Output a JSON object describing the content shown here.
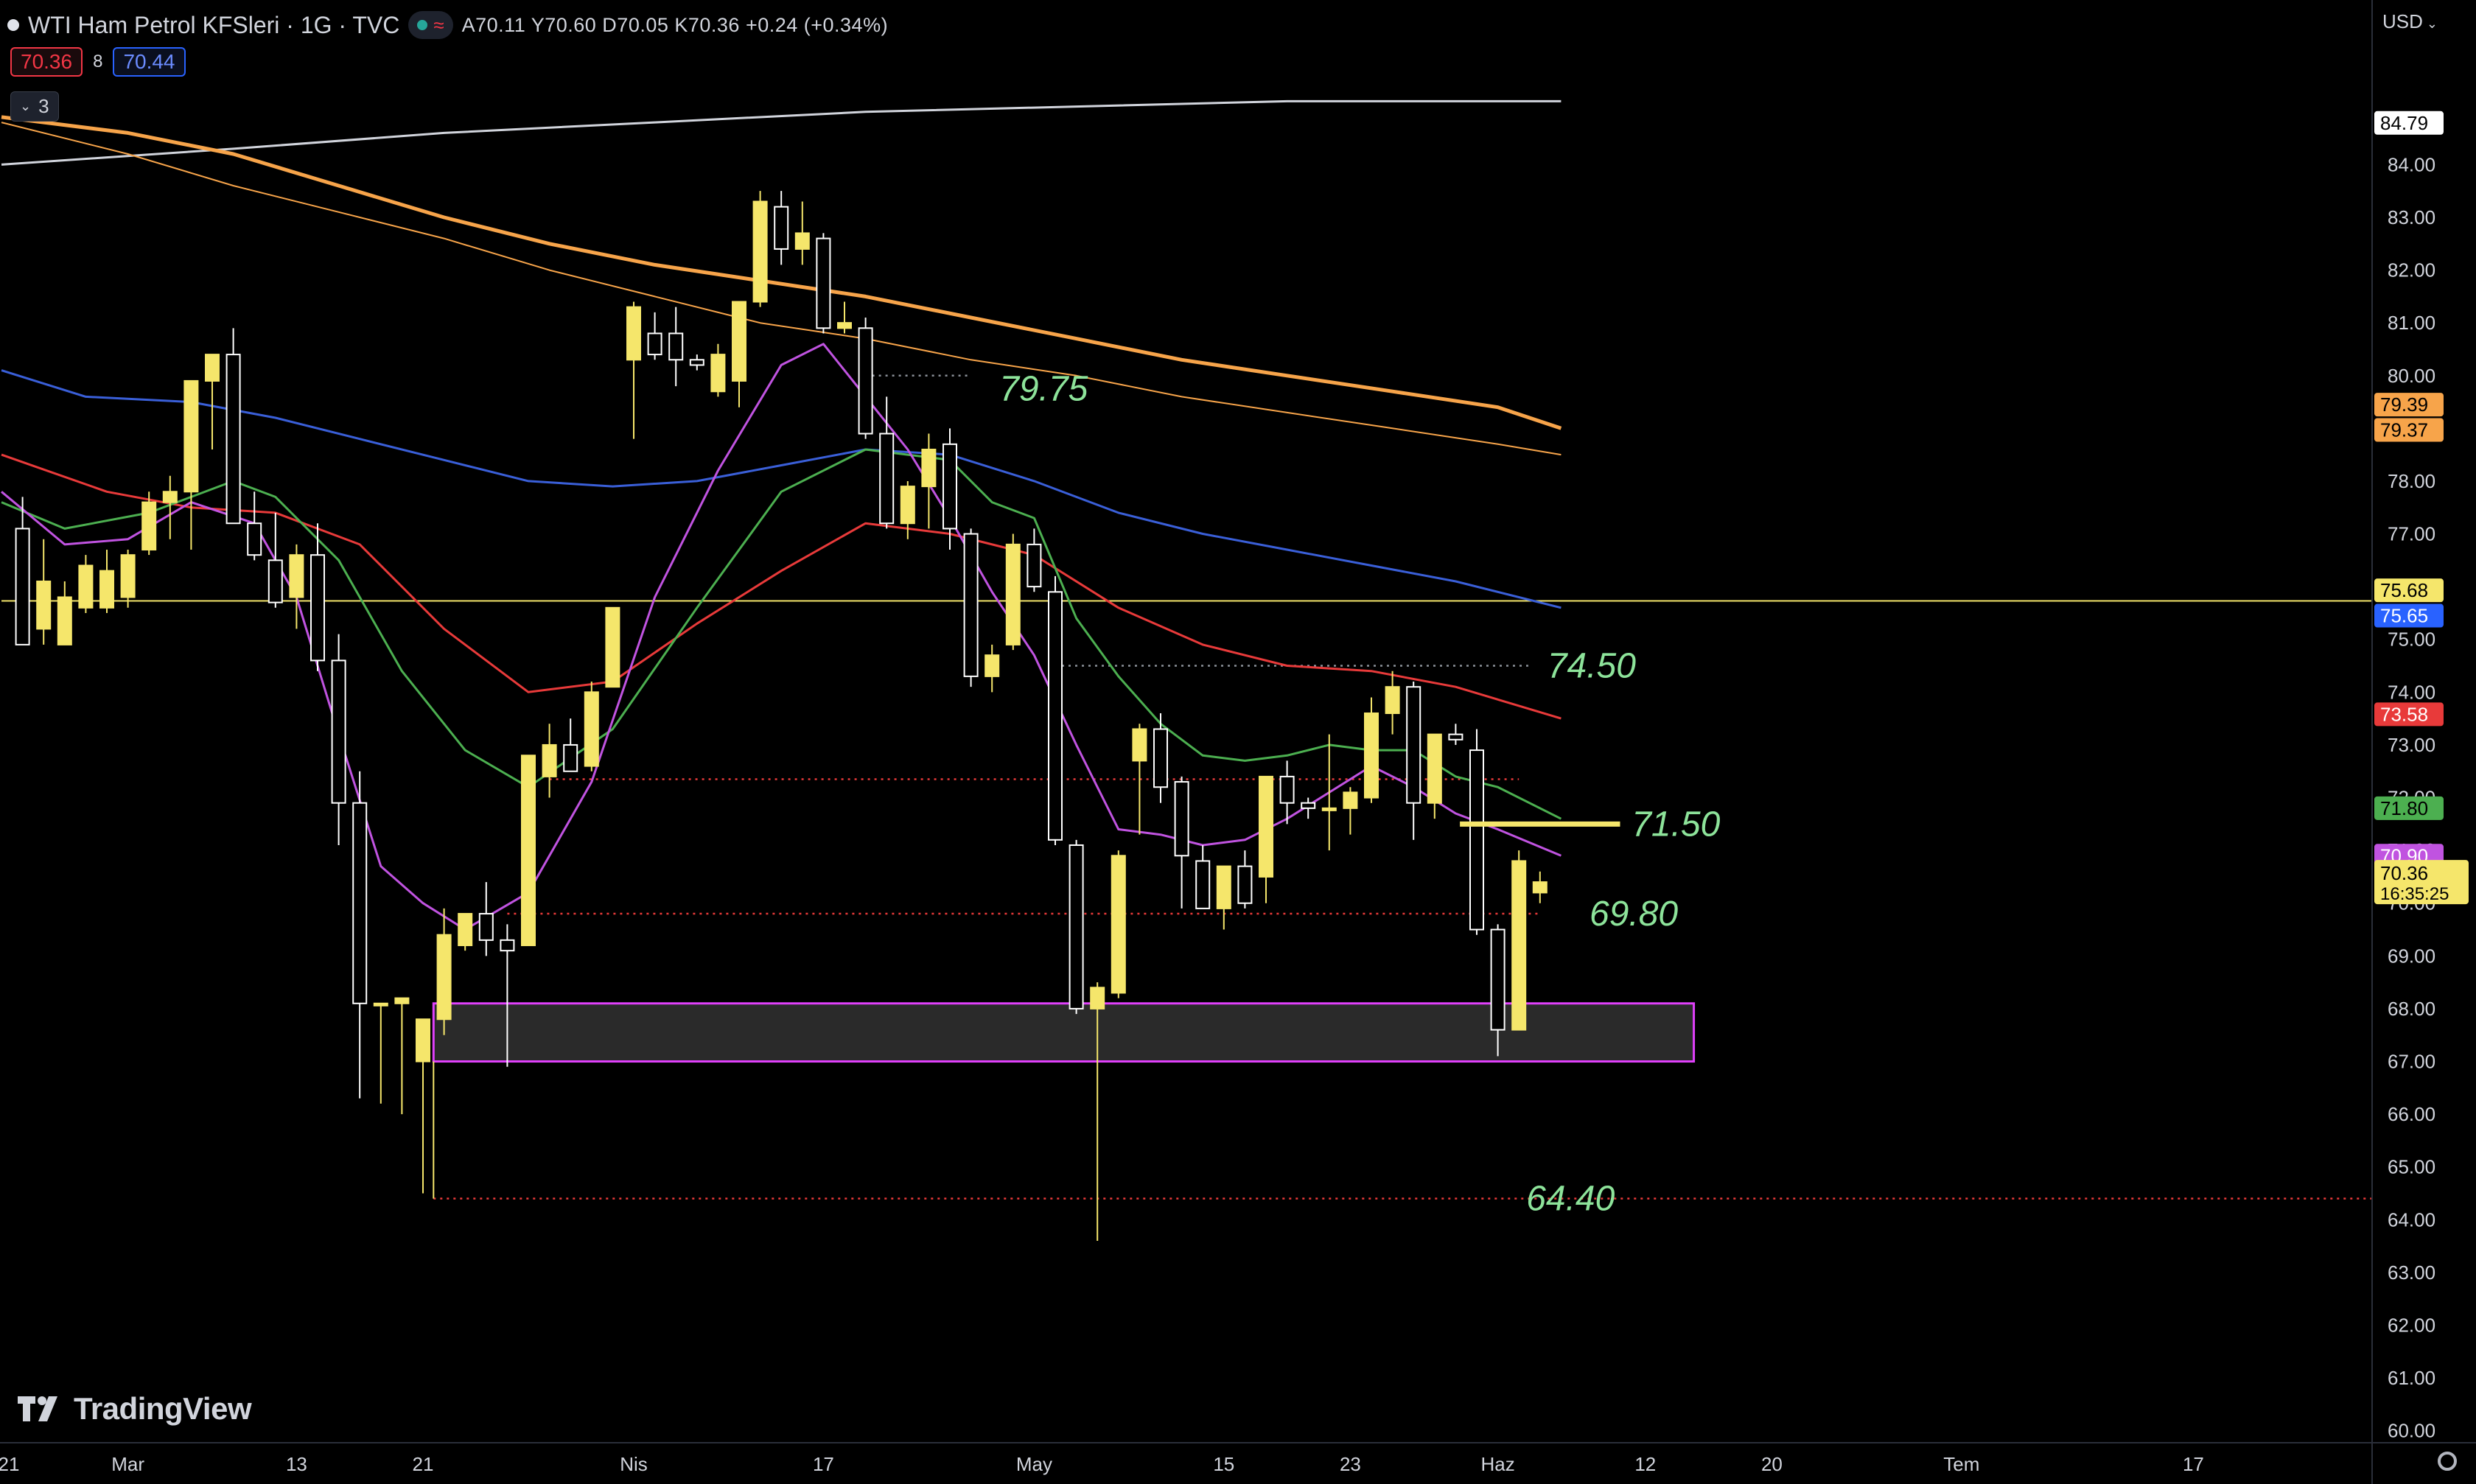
{
  "header": {
    "symbol": "WTI Ham Petrol KFSleri · 1G · TVC",
    "ohlc": "A70.11 Y70.60 D70.05 K70.36 +0.24 (+0.34%)",
    "pill_icon": "wave-icon",
    "bid": "70.36",
    "spread": "8",
    "ask": "70.44",
    "indicators_toggle": "3",
    "currency": "USD"
  },
  "colors": {
    "bull": "#f5e66b",
    "bear": "#ffffff",
    "ema_white": "#d1d4dc",
    "ema_orange": "#f7a44a",
    "ema_blue": "#3a5fd8",
    "ema_red": "#e83a3a",
    "ema_green": "#4caf50",
    "ema_purple": "#c053e0",
    "zone": "#e040fb",
    "level_green": "#8de39a"
  },
  "price_axis": {
    "labels": [
      "84.00",
      "83.00",
      "82.00",
      "81.00",
      "80.00",
      "79.00",
      "78.00",
      "77.00",
      "76.00",
      "75.00",
      "74.00",
      "73.00",
      "72.00",
      "71.00",
      "70.00",
      "69.00",
      "68.00",
      "67.00",
      "66.00",
      "65.00",
      "64.00",
      "63.00",
      "62.00",
      "61.00",
      "60.00"
    ],
    "tags": [
      {
        "text": "84.79",
        "price": 84.79,
        "bg": "#ffffff",
        "fg": "#000000"
      },
      {
        "text": "79.39",
        "price": 79.45,
        "bg": "#f7a44a",
        "fg": "#000000"
      },
      {
        "text": "79.37",
        "price": 78.97,
        "bg": "#f7a44a",
        "fg": "#000000"
      },
      {
        "text": "75.68",
        "price": 75.93,
        "bg": "#f5e66b",
        "fg": "#000000"
      },
      {
        "text": "75.65",
        "price": 75.45,
        "bg": "#2962ff",
        "fg": "#ffffff"
      },
      {
        "text": "73.58",
        "price": 73.58,
        "bg": "#e83a3a",
        "fg": "#ffffff"
      },
      {
        "text": "71.80",
        "price": 71.8,
        "bg": "#4caf50",
        "fg": "#000000"
      },
      {
        "text": "70.90",
        "price": 70.9,
        "bg": "#c053e0",
        "fg": "#ffffff"
      }
    ],
    "current_price": "70.36",
    "countdown": "16:35:25"
  },
  "time_axis": {
    "labels": [
      {
        "text": "21",
        "i": -1
      },
      {
        "text": "Mar",
        "i": 5
      },
      {
        "text": "13",
        "i": 13
      },
      {
        "text": "21",
        "i": 19
      },
      {
        "text": "Nis",
        "i": 29
      },
      {
        "text": "17",
        "i": 38
      },
      {
        "text": "May",
        "i": 48
      },
      {
        "text": "15",
        "i": 57
      },
      {
        "text": "23",
        "i": 63
      },
      {
        "text": "Haz",
        "i": 70
      },
      {
        "text": "12",
        "i": 77
      },
      {
        "text": "20",
        "i": 83
      },
      {
        "text": "Tem",
        "i": 92
      },
      {
        "text": "17",
        "i": 103
      }
    ]
  },
  "annotations": [
    {
      "text": "79.75",
      "price": 79.75,
      "i": 46
    },
    {
      "text": "74.50",
      "price": 74.5,
      "i": 72
    },
    {
      "text": "71.50",
      "price": 71.5,
      "i": 76
    },
    {
      "text": "69.80",
      "price": 69.8,
      "i": 74
    },
    {
      "text": "64.40",
      "price": 64.4,
      "i": 71
    }
  ],
  "branding": {
    "logo_icon": "tradingview-logo-icon",
    "name": "TradingView"
  },
  "chart_data": {
    "type": "candlestick",
    "ylim": [
      59.7,
      85.6
    ],
    "candles": [
      {
        "o": 77.1,
        "h": 77.7,
        "l": 74.9,
        "c": 74.9
      },
      {
        "o": 75.2,
        "h": 76.9,
        "l": 74.9,
        "c": 76.1
      },
      {
        "o": 74.9,
        "h": 76.1,
        "l": 74.9,
        "c": 75.8
      },
      {
        "o": 75.6,
        "h": 76.6,
        "l": 75.5,
        "c": 76.4
      },
      {
        "o": 75.6,
        "h": 76.7,
        "l": 75.5,
        "c": 76.3
      },
      {
        "o": 75.8,
        "h": 76.7,
        "l": 75.6,
        "c": 76.6
      },
      {
        "o": 76.7,
        "h": 77.8,
        "l": 76.6,
        "c": 77.6
      },
      {
        "o": 77.6,
        "h": 78.1,
        "l": 76.9,
        "c": 77.8
      },
      {
        "o": 77.8,
        "h": 78.6,
        "l": 76.7,
        "c": 79.9
      },
      {
        "o": 79.9,
        "h": 80.4,
        "l": 78.6,
        "c": 80.4
      },
      {
        "o": 80.4,
        "h": 80.9,
        "l": 77.2,
        "c": 77.2
      },
      {
        "o": 77.2,
        "h": 77.8,
        "l": 76.5,
        "c": 76.6
      },
      {
        "o": 76.5,
        "h": 77.4,
        "l": 75.6,
        "c": 75.7
      },
      {
        "o": 75.8,
        "h": 76.8,
        "l": 75.2,
        "c": 76.6
      },
      {
        "o": 76.6,
        "h": 77.2,
        "l": 74.4,
        "c": 74.6
      },
      {
        "o": 74.6,
        "h": 75.1,
        "l": 71.1,
        "c": 71.9
      },
      {
        "o": 71.9,
        "h": 72.5,
        "l": 66.3,
        "c": 68.1
      },
      {
        "o": 68.1,
        "h": 68.1,
        "l": 66.2,
        "c": 68.1
      },
      {
        "o": 68.1,
        "h": 68.1,
        "l": 66.0,
        "c": 68.2
      },
      {
        "o": 67.0,
        "h": 67.8,
        "l": 64.5,
        "c": 67.8
      },
      {
        "o": 67.8,
        "h": 69.9,
        "l": 67.5,
        "c": 69.4
      },
      {
        "o": 69.2,
        "h": 69.8,
        "l": 69.1,
        "c": 69.8
      },
      {
        "o": 69.8,
        "h": 70.4,
        "l": 69.0,
        "c": 69.3
      },
      {
        "o": 69.3,
        "h": 69.6,
        "l": 66.9,
        "c": 69.1
      },
      {
        "o": 69.2,
        "h": 72.8,
        "l": 69.2,
        "c": 72.8
      },
      {
        "o": 72.4,
        "h": 73.4,
        "l": 72.0,
        "c": 73.0
      },
      {
        "o": 73.0,
        "h": 73.5,
        "l": 72.5,
        "c": 72.5
      },
      {
        "o": 72.6,
        "h": 74.2,
        "l": 72.5,
        "c": 74.0
      },
      {
        "o": 74.1,
        "h": 75.6,
        "l": 74.1,
        "c": 75.6
      },
      {
        "o": 80.3,
        "h": 81.4,
        "l": 78.8,
        "c": 81.3
      },
      {
        "o": 80.8,
        "h": 81.2,
        "l": 80.3,
        "c": 80.4
      },
      {
        "o": 80.8,
        "h": 81.3,
        "l": 79.8,
        "c": 80.3
      },
      {
        "o": 80.3,
        "h": 80.4,
        "l": 80.1,
        "c": 80.2
      },
      {
        "o": 79.7,
        "h": 80.6,
        "l": 79.6,
        "c": 80.4
      },
      {
        "o": 79.9,
        "h": 81.4,
        "l": 79.4,
        "c": 81.4
      },
      {
        "o": 81.4,
        "h": 83.5,
        "l": 81.3,
        "c": 83.3
      },
      {
        "o": 83.2,
        "h": 83.5,
        "l": 82.1,
        "c": 82.4
      },
      {
        "o": 82.4,
        "h": 83.3,
        "l": 82.1,
        "c": 82.7
      },
      {
        "o": 82.6,
        "h": 82.7,
        "l": 80.8,
        "c": 80.9
      },
      {
        "o": 80.9,
        "h": 81.4,
        "l": 80.8,
        "c": 81.0
      },
      {
        "o": 80.9,
        "h": 81.1,
        "l": 78.8,
        "c": 78.9
      },
      {
        "o": 78.9,
        "h": 79.6,
        "l": 77.1,
        "c": 77.2
      },
      {
        "o": 77.2,
        "h": 78.0,
        "l": 76.9,
        "c": 77.9
      },
      {
        "o": 77.9,
        "h": 78.9,
        "l": 77.1,
        "c": 78.6
      },
      {
        "o": 78.7,
        "h": 79.0,
        "l": 76.7,
        "c": 77.1
      },
      {
        "o": 77.0,
        "h": 77.1,
        "l": 74.1,
        "c": 74.3
      },
      {
        "o": 74.3,
        "h": 74.9,
        "l": 74.0,
        "c": 74.7
      },
      {
        "o": 74.9,
        "h": 77.0,
        "l": 74.8,
        "c": 76.8
      },
      {
        "o": 76.8,
        "h": 77.1,
        "l": 75.9,
        "c": 76.0
      },
      {
        "o": 75.9,
        "h": 76.2,
        "l": 71.1,
        "c": 71.2
      },
      {
        "o": 71.1,
        "h": 71.2,
        "l": 67.9,
        "c": 68.0
      },
      {
        "o": 68.0,
        "h": 68.5,
        "l": 63.6,
        "c": 68.4
      },
      {
        "o": 68.3,
        "h": 71.0,
        "l": 68.2,
        "c": 70.9
      },
      {
        "o": 72.7,
        "h": 73.4,
        "l": 71.3,
        "c": 73.3
      },
      {
        "o": 73.3,
        "h": 73.6,
        "l": 71.9,
        "c": 72.2
      },
      {
        "o": 72.3,
        "h": 72.4,
        "l": 69.9,
        "c": 70.9
      },
      {
        "o": 70.8,
        "h": 71.1,
        "l": 69.9,
        "c": 69.9
      },
      {
        "o": 69.9,
        "h": 70.7,
        "l": 69.5,
        "c": 70.7
      },
      {
        "o": 70.7,
        "h": 71.0,
        "l": 69.9,
        "c": 70.0
      },
      {
        "o": 70.5,
        "h": 72.4,
        "l": 70.0,
        "c": 72.4
      },
      {
        "o": 72.4,
        "h": 72.7,
        "l": 71.5,
        "c": 71.9
      },
      {
        "o": 71.9,
        "h": 72.0,
        "l": 71.6,
        "c": 71.8
      },
      {
        "o": 71.8,
        "h": 73.2,
        "l": 71.0,
        "c": 71.8
      },
      {
        "o": 71.8,
        "h": 72.2,
        "l": 71.3,
        "c": 72.1
      },
      {
        "o": 72.0,
        "h": 73.9,
        "l": 71.9,
        "c": 73.6
      },
      {
        "o": 73.6,
        "h": 74.4,
        "l": 73.2,
        "c": 74.1
      },
      {
        "o": 74.1,
        "h": 74.2,
        "l": 71.2,
        "c": 71.9
      },
      {
        "o": 71.9,
        "h": 73.2,
        "l": 71.6,
        "c": 73.2
      },
      {
        "o": 73.2,
        "h": 73.4,
        "l": 73.0,
        "c": 73.1
      },
      {
        "o": 72.9,
        "h": 73.3,
        "l": 69.4,
        "c": 69.5
      },
      {
        "o": 69.5,
        "h": 69.6,
        "l": 67.1,
        "c": 67.6
      },
      {
        "o": 67.6,
        "h": 71.0,
        "l": 67.6,
        "c": 70.8
      },
      {
        "o": 70.2,
        "h": 70.6,
        "l": 70.0,
        "c": 70.4
      }
    ],
    "series": [
      {
        "color": "#d1d4dc",
        "width": 3,
        "points": [
          [
            -1,
            84.0
          ],
          [
            10,
            84.3
          ],
          [
            20,
            84.6
          ],
          [
            30,
            84.8
          ],
          [
            40,
            85.0
          ],
          [
            50,
            85.1
          ],
          [
            60,
            85.2
          ],
          [
            70,
            85.2
          ],
          [
            73,
            85.2
          ]
        ]
      },
      {
        "color": "#f7a44a",
        "width": 2,
        "points": [
          [
            -1,
            84.8
          ],
          [
            5,
            84.2
          ],
          [
            10,
            83.6
          ],
          [
            15,
            83.1
          ],
          [
            20,
            82.6
          ],
          [
            25,
            82.0
          ],
          [
            30,
            81.5
          ],
          [
            35,
            81.0
          ],
          [
            40,
            80.7
          ],
          [
            45,
            80.3
          ],
          [
            50,
            80.0
          ],
          [
            55,
            79.6
          ],
          [
            60,
            79.3
          ],
          [
            65,
            79.0
          ],
          [
            70,
            78.7
          ],
          [
            73,
            78.5
          ]
        ]
      },
      {
        "color": "#f7a44a",
        "width": 5,
        "points": [
          [
            -1,
            84.9
          ],
          [
            5,
            84.6
          ],
          [
            10,
            84.2
          ],
          [
            15,
            83.6
          ],
          [
            20,
            83.0
          ],
          [
            25,
            82.5
          ],
          [
            30,
            82.1
          ],
          [
            35,
            81.8
          ],
          [
            40,
            81.5
          ],
          [
            45,
            81.1
          ],
          [
            50,
            80.7
          ],
          [
            55,
            80.3
          ],
          [
            60,
            80.0
          ],
          [
            65,
            79.7
          ],
          [
            70,
            79.4
          ],
          [
            73,
            79.0
          ]
        ]
      },
      {
        "color": "#3a5fd8",
        "width": 3,
        "points": [
          [
            -1,
            80.1
          ],
          [
            3,
            79.6
          ],
          [
            8,
            79.5
          ],
          [
            12,
            79.2
          ],
          [
            16,
            78.8
          ],
          [
            20,
            78.4
          ],
          [
            24,
            78.0
          ],
          [
            28,
            77.9
          ],
          [
            32,
            78.0
          ],
          [
            36,
            78.3
          ],
          [
            40,
            78.6
          ],
          [
            44,
            78.5
          ],
          [
            48,
            78.0
          ],
          [
            52,
            77.4
          ],
          [
            56,
            77.0
          ],
          [
            60,
            76.7
          ],
          [
            64,
            76.4
          ],
          [
            68,
            76.1
          ],
          [
            73,
            75.6
          ]
        ]
      },
      {
        "color": "#e83a3a",
        "width": 3,
        "points": [
          [
            -1,
            78.5
          ],
          [
            4,
            77.8
          ],
          [
            8,
            77.5
          ],
          [
            12,
            77.4
          ],
          [
            16,
            76.8
          ],
          [
            20,
            75.2
          ],
          [
            24,
            74.0
          ],
          [
            28,
            74.2
          ],
          [
            32,
            75.3
          ],
          [
            36,
            76.3
          ],
          [
            40,
            77.2
          ],
          [
            44,
            77.0
          ],
          [
            48,
            76.6
          ],
          [
            52,
            75.6
          ],
          [
            56,
            74.9
          ],
          [
            60,
            74.5
          ],
          [
            64,
            74.4
          ],
          [
            68,
            74.1
          ],
          [
            73,
            73.5
          ]
        ]
      },
      {
        "color": "#4caf50",
        "width": 3,
        "points": [
          [
            -1,
            77.6
          ],
          [
            2,
            77.1
          ],
          [
            6,
            77.4
          ],
          [
            10,
            78.0
          ],
          [
            12,
            77.7
          ],
          [
            15,
            76.5
          ],
          [
            18,
            74.4
          ],
          [
            21,
            72.9
          ],
          [
            24,
            72.2
          ],
          [
            28,
            73.3
          ],
          [
            32,
            75.6
          ],
          [
            36,
            77.8
          ],
          [
            40,
            78.6
          ],
          [
            44,
            78.4
          ],
          [
            46,
            77.6
          ],
          [
            48,
            77.3
          ],
          [
            50,
            75.4
          ],
          [
            52,
            74.3
          ],
          [
            54,
            73.4
          ],
          [
            56,
            72.8
          ],
          [
            58,
            72.7
          ],
          [
            60,
            72.8
          ],
          [
            62,
            73.0
          ],
          [
            64,
            72.9
          ],
          [
            66,
            72.9
          ],
          [
            68,
            72.4
          ],
          [
            70,
            72.2
          ],
          [
            73,
            71.6
          ]
        ]
      },
      {
        "color": "#c053e0",
        "width": 3,
        "points": [
          [
            -1,
            77.8
          ],
          [
            2,
            76.8
          ],
          [
            5,
            76.9
          ],
          [
            8,
            77.6
          ],
          [
            11,
            77.2
          ],
          [
            13,
            75.8
          ],
          [
            15,
            73.2
          ],
          [
            17,
            70.7
          ],
          [
            19,
            70.0
          ],
          [
            21,
            69.5
          ],
          [
            24,
            70.2
          ],
          [
            27,
            72.3
          ],
          [
            30,
            75.8
          ],
          [
            33,
            78.2
          ],
          [
            36,
            80.2
          ],
          [
            38,
            80.6
          ],
          [
            40,
            79.6
          ],
          [
            42,
            78.6
          ],
          [
            44,
            77.3
          ],
          [
            46,
            75.9
          ],
          [
            48,
            74.7
          ],
          [
            50,
            73.0
          ],
          [
            52,
            71.4
          ],
          [
            54,
            71.3
          ],
          [
            56,
            71.1
          ],
          [
            58,
            71.2
          ],
          [
            60,
            71.6
          ],
          [
            62,
            72.1
          ],
          [
            64,
            72.6
          ],
          [
            66,
            72.2
          ],
          [
            68,
            71.7
          ],
          [
            70,
            71.4
          ],
          [
            73,
            70.9
          ]
        ]
      }
    ],
    "zone": {
      "i0": 19.5,
      "i1": 79.3,
      "top": 68.1,
      "bottom": 67.0
    },
    "hlines": [
      {
        "price": 75.73,
        "color": "#f5e66b",
        "style": "solid",
        "i0": -1,
        "i1": null
      },
      {
        "price": 72.35,
        "color": "#e83a3a",
        "style": "dotted",
        "i0": 25,
        "i1": 71
      },
      {
        "price": 69.8,
        "color": "#e83a3a",
        "style": "dotted",
        "i0": 23,
        "i1": 72
      },
      {
        "price": 64.4,
        "color": "#e83a3a",
        "style": "dotted",
        "i0": 19.5,
        "i1": null
      },
      {
        "price": 80.0,
        "color": "#8a8f98",
        "style": "dotted",
        "i0": 40,
        "i1": 45
      },
      {
        "price": 74.5,
        "color": "#8a8f98",
        "style": "dotted",
        "i0": 49,
        "i1": 71.5
      }
    ],
    "segments": [
      {
        "price": 71.5,
        "i0": 68.2,
        "i1": 75.8,
        "color": "#f5e66b",
        "width": 7
      }
    ]
  }
}
